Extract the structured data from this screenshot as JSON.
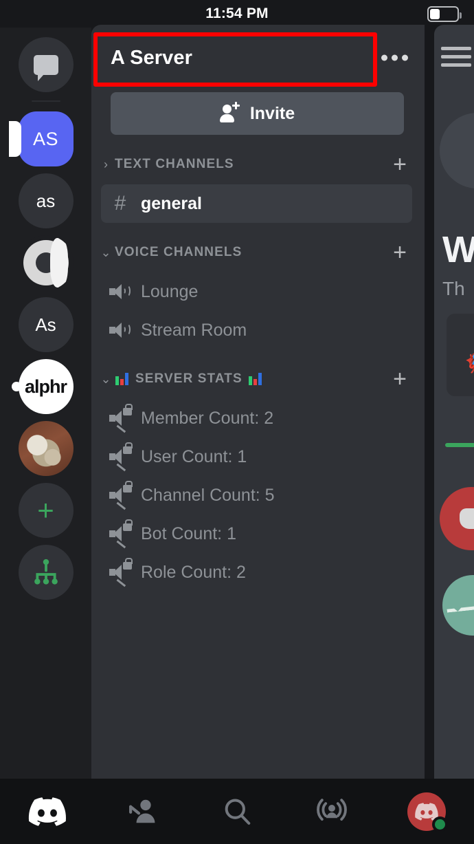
{
  "status_bar": {
    "time": "11:54 PM",
    "battery_icon": "battery-icon",
    "battery_level_pct": 35
  },
  "server_rail": {
    "items": [
      {
        "label": "",
        "icon": "direct-messages-icon",
        "type": "dm",
        "selected": false,
        "unread": false
      },
      {
        "label": "AS",
        "icon": "server-avatar-as-blurple",
        "type": "initials",
        "selected": true,
        "unread": false,
        "color": "#5865f2"
      },
      {
        "label": "as",
        "icon": "server-avatar-as-lower",
        "type": "initials",
        "selected": false,
        "unread": false,
        "color": "#313338"
      },
      {
        "label": "",
        "icon": "server-avatar-o-mark",
        "type": "image",
        "selected": false,
        "unread": false
      },
      {
        "label": "As",
        "icon": "server-avatar-as-mixed",
        "type": "initials",
        "selected": false,
        "unread": false,
        "color": "#313338"
      },
      {
        "label": "alphr",
        "icon": "server-avatar-alphr",
        "type": "logo",
        "selected": false,
        "unread": true,
        "color": "#ffffff"
      },
      {
        "label": "",
        "icon": "server-avatar-dog-photo",
        "type": "photo",
        "selected": false,
        "unread": false
      },
      {
        "label": "",
        "icon": "add-server-icon",
        "type": "action",
        "selected": false,
        "unread": false,
        "color": "#3ba55d"
      },
      {
        "label": "",
        "icon": "explore-servers-icon",
        "type": "action",
        "selected": false,
        "unread": false,
        "color": "#3ba55d"
      }
    ]
  },
  "server_panel": {
    "name": "A Server",
    "overflow_icon": "more-options-icon",
    "highlight_color": "#fe0000",
    "invite": {
      "label": "Invite",
      "icon": "person-add-icon"
    },
    "categories": [
      {
        "name": "TEXT CHANNELS",
        "collapsed": true,
        "chevron_icon": "chevron-right-icon",
        "add_icon": "add-channel-icon",
        "emoji_left": "",
        "emoji_right": "",
        "channels": [
          {
            "name": "general",
            "icon": "hash-icon",
            "selected": true
          }
        ]
      },
      {
        "name": "VOICE CHANNELS",
        "collapsed": false,
        "chevron_icon": "chevron-down-icon",
        "add_icon": "add-channel-icon",
        "emoji_left": "",
        "emoji_right": "",
        "channels": [
          {
            "name": "Lounge",
            "icon": "speaker-icon",
            "selected": false
          },
          {
            "name": "Stream Room",
            "icon": "speaker-icon",
            "selected": false
          }
        ]
      },
      {
        "name": "SERVER STATS",
        "collapsed": false,
        "chevron_icon": "chevron-down-icon",
        "add_icon": "add-channel-icon",
        "emoji_left": "bar-chart-emoji",
        "emoji_right": "bar-chart-emoji",
        "channels": [
          {
            "name": "Member Count: 2",
            "icon": "locked-speaker-icon",
            "selected": false
          },
          {
            "name": "User Count: 1",
            "icon": "locked-speaker-icon",
            "selected": false
          },
          {
            "name": "Channel Count: 5",
            "icon": "locked-speaker-icon",
            "selected": false
          },
          {
            "name": "Bot Count: 1",
            "icon": "locked-speaker-icon",
            "selected": false
          },
          {
            "name": "Role Count: 2",
            "icon": "locked-speaker-icon",
            "selected": false
          }
        ]
      }
    ]
  },
  "chat_peek": {
    "menu_icon": "hamburger-menu-icon",
    "heading_fragment": "W",
    "subtitle_fragment": "Th",
    "card_emoji": "🦸"
  },
  "bottom_nav": {
    "items": [
      {
        "name": "servers-tab",
        "icon": "discord-logo-icon",
        "active": true
      },
      {
        "name": "friends-tab",
        "icon": "friends-icon",
        "active": false
      },
      {
        "name": "search-tab",
        "icon": "search-icon",
        "active": false
      },
      {
        "name": "mentions-tab",
        "icon": "mentions-icon",
        "active": false
      },
      {
        "name": "profile-tab",
        "icon": "user-avatar-icon",
        "active": false,
        "status": "online"
      }
    ]
  }
}
